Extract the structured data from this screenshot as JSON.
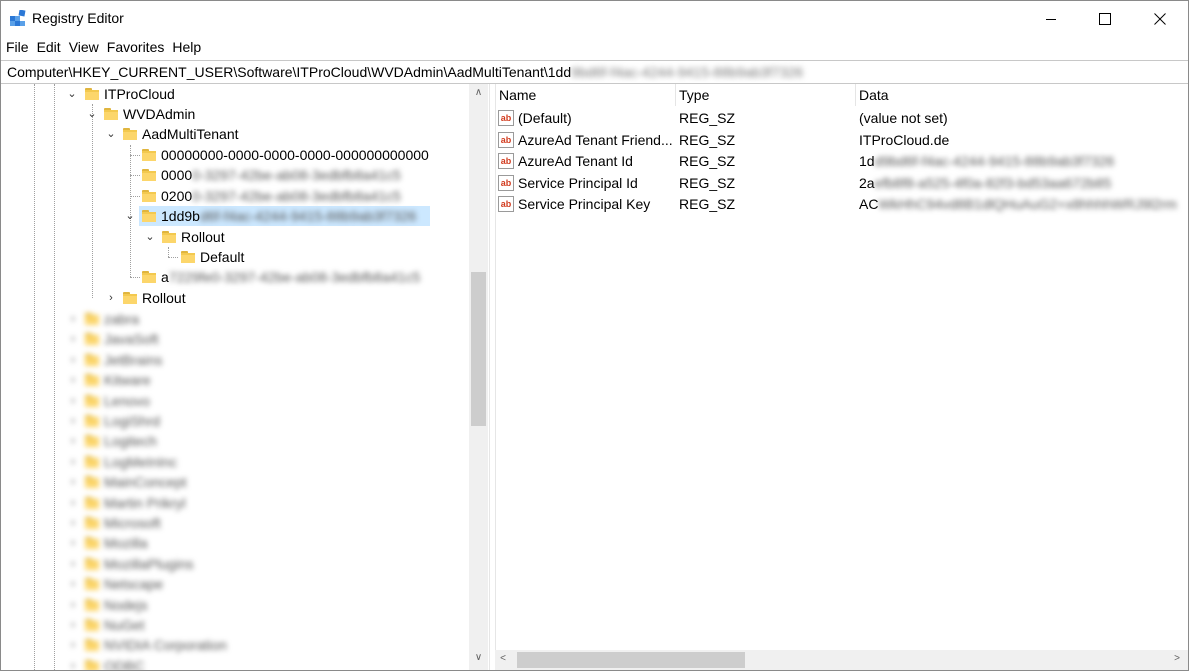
{
  "window": {
    "title": "Registry Editor"
  },
  "menu": [
    "File",
    "Edit",
    "View",
    "Favorites",
    "Help"
  ],
  "address": {
    "visible": "Computer\\HKEY_CURRENT_USER\\Software\\ITProCloud\\WVDAdmin\\AadMultiTenant\\1dd",
    "blurred": "9bd6f-f4ac-4244-9415-88b9ab3f7326"
  },
  "tree": {
    "itprocloud": "ITProCloud",
    "wvdadmin": "WVDAdmin",
    "aadmultitenant": "AadMultiTenant",
    "keys": [
      {
        "visible": "00000000-0000-0000-0000-000000000000",
        "blurred": ""
      },
      {
        "visible": "0000",
        "blurred": "0-3297-42be-ab08-3edbfb8a41c5"
      },
      {
        "visible": "0200",
        "blurred": "0-3297-42be-ab08-3edbfb8a41c5"
      },
      {
        "visible": "1dd9b",
        "blurred": "d6f-f4ac-4244-9415-88b9ab3f7326"
      }
    ],
    "rollout_sub": "Rollout",
    "default_sub": "Default",
    "last_key": {
      "visible": "a",
      "blurred": "7229fe0-3297-42be-ab08-3edbfb8a41c5"
    },
    "rollout": "Rollout",
    "ghost_items": [
      "zabra",
      "JavaSoft",
      "JetBrains",
      "Kitware",
      "Lenovo",
      "LogiShrd",
      "Logitech",
      "LogMeInInc",
      "MainConcept",
      "Martin Prikryl",
      "Microsoft",
      "Mozilla",
      "MozillaPlugins",
      "Netscape",
      "Nodejs",
      "NuGet",
      "NVIDIA Corporation",
      "ODBC"
    ]
  },
  "list": {
    "headers": {
      "name": "Name",
      "type": "Type",
      "data": "Data"
    },
    "rows": [
      {
        "name": "(Default)",
        "type": "REG_SZ",
        "data_visible": "(value not set)",
        "data_blurred": ""
      },
      {
        "name": "AzureAd Tenant Friend...",
        "type": "REG_SZ",
        "data_visible": "ITProCloud.de",
        "data_blurred": ""
      },
      {
        "name": "AzureAd Tenant Id",
        "type": "REG_SZ",
        "data_visible": "1d",
        "data_blurred": "d9bd6f-f4ac-4244-9415-88b9ab3f7326"
      },
      {
        "name": "Service Principal Id",
        "type": "REG_SZ",
        "data_visible": "2a",
        "data_blurred": "efb8f8-a525-4f0a-82f3-bd53aa672b85"
      },
      {
        "name": "Service Principal Key",
        "type": "REG_SZ",
        "data_visible": "AC",
        "data_blurred": "WkHhC94vd8B1dlQHuAuG2+x8hhhhWRJ9l2rm"
      }
    ]
  },
  "icons": {
    "value": "ab-icon",
    "app": "registry-icon"
  },
  "colors": {
    "selection": "#cce8ff",
    "folder": "#f3c94f"
  }
}
